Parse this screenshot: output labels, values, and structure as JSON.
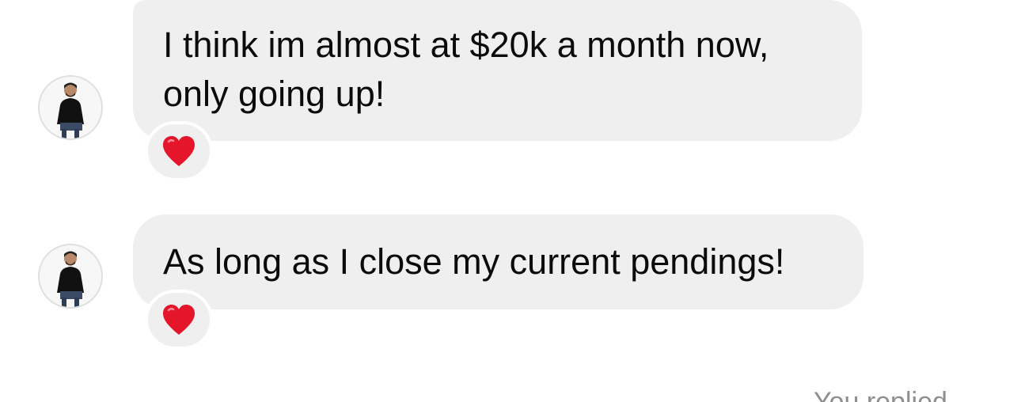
{
  "messages": [
    {
      "lines": [
        "I think im almost at $20k a month now,",
        "only going up!"
      ],
      "reaction": "heart-emoji"
    },
    {
      "lines": [
        "As long as I close my current pendings!"
      ],
      "reaction": "heart-emoji"
    }
  ],
  "reply_note": "You replied",
  "colors": {
    "bubble": "#efefef",
    "text": "#0b0b0b",
    "heart": "#e5152a",
    "muted": "#8e8e8e"
  }
}
